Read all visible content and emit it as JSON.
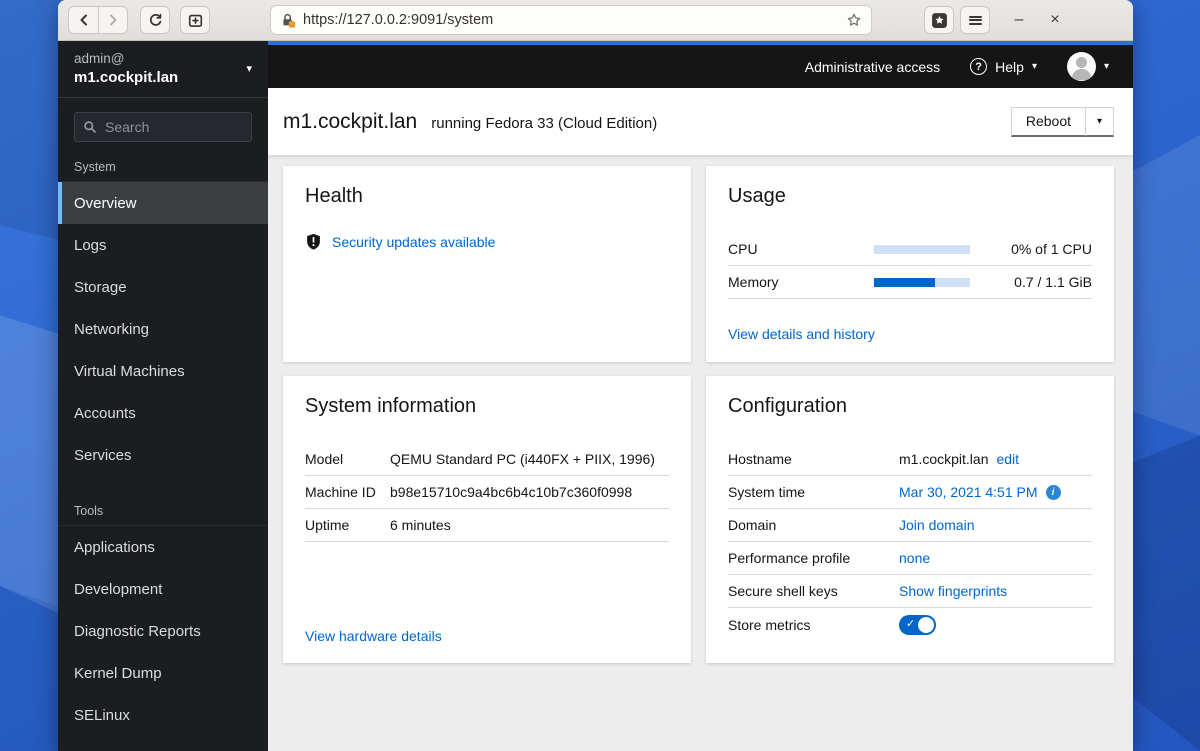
{
  "glyphs": {
    "caret_down": "▾",
    "minimize": "–",
    "close": "×",
    "check": "✓",
    "info": "i",
    "question": "?"
  },
  "colors": {
    "link": "#0066cc",
    "masthead_bg": "#151515",
    "masthead_accent": "#2273df",
    "selected_indicator": "#73bcf7",
    "progress_track": "#cfe1f6",
    "progress_fill": "#0066cc",
    "toggle_on": "#0066cc",
    "lock_warning": "#e89b2e",
    "sidebar_bg": "#1b1d21"
  },
  "browser": {
    "url": "https://127.0.0.2:9091/system"
  },
  "sidebar": {
    "account": "admin@",
    "host": "m1.cockpit.lan",
    "search_placeholder": "Search",
    "groups": [
      {
        "label": "System",
        "items": [
          {
            "label": "Overview",
            "selected": true
          },
          {
            "label": "Logs"
          },
          {
            "label": "Storage"
          },
          {
            "label": "Networking"
          },
          {
            "label": "Virtual Machines"
          },
          {
            "label": "Accounts"
          },
          {
            "label": "Services"
          }
        ]
      },
      {
        "label": "Tools",
        "items": [
          {
            "label": "Applications"
          },
          {
            "label": "Development"
          },
          {
            "label": "Diagnostic Reports"
          },
          {
            "label": "Kernel Dump"
          },
          {
            "label": "SELinux"
          }
        ]
      }
    ]
  },
  "masthead": {
    "admin_access": "Administrative access",
    "help": "Help"
  },
  "page_header": {
    "hostname": "m1.cockpit.lan",
    "subtitle": "running Fedora 33 (Cloud Edition)",
    "reboot_label": "Reboot"
  },
  "cards": {
    "health": {
      "title": "Health",
      "security_link": "Security updates available"
    },
    "usage": {
      "title": "Usage",
      "rows": [
        {
          "label": "CPU",
          "percent": 0,
          "value": "0% of 1 CPU"
        },
        {
          "label": "Memory",
          "percent": 64,
          "value": "0.7 / 1.1 GiB"
        }
      ],
      "link": "View details and history"
    },
    "system_information": {
      "title": "System information",
      "rows": [
        {
          "label": "Model",
          "value": "QEMU Standard PC (i440FX + PIIX, 1996)"
        },
        {
          "label": "Machine ID",
          "value": "b98e15710c9a4bc6b4c10b7c360f0998"
        },
        {
          "label": "Uptime",
          "value": "6 minutes"
        }
      ],
      "link": "View hardware details"
    },
    "configuration": {
      "title": "Configuration",
      "rows": [
        {
          "label": "Hostname",
          "value": "m1.cockpit.lan",
          "link": "edit"
        },
        {
          "label": "System time",
          "link": "Mar 30, 2021 4:51 PM"
        },
        {
          "label": "Domain",
          "link": "Join domain"
        },
        {
          "label": "Performance profile",
          "link": "none"
        },
        {
          "label": "Secure shell keys",
          "link": "Show fingerprints"
        },
        {
          "label": "Store metrics",
          "toggle_on": true
        }
      ]
    }
  }
}
